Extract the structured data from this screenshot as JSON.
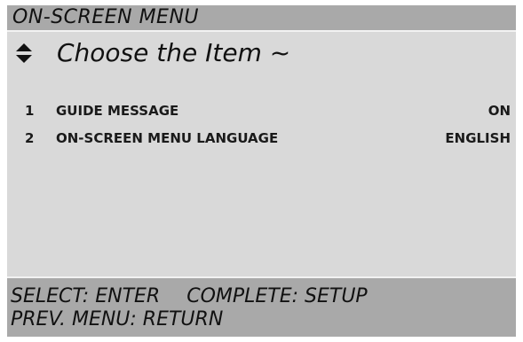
{
  "menu": {
    "title": "ON-SCREEN MENU",
    "prompt": "Choose the Item ~",
    "items": [
      {
        "number": "1",
        "label": "GUIDE MESSAGE",
        "value": "ON"
      },
      {
        "number": "2",
        "label": "ON-SCREEN MENU LANGUAGE",
        "value": "ENGLISH"
      }
    ]
  },
  "footer": {
    "select_hint": "SELECT: ENTER",
    "complete_hint": "COMPLETE: SETUP",
    "prev_hint": "PREV. MENU: RETURN"
  },
  "icons": {
    "navigate": "up-down-triangles-icon"
  },
  "colors": {
    "background": "#d9d9d9",
    "bars": "#a9a9a9",
    "text": "#111111"
  }
}
